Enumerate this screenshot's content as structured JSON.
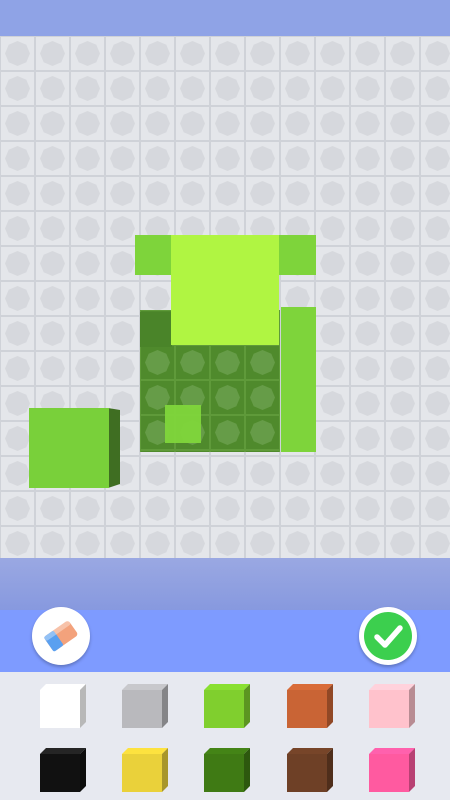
{
  "colors": {
    "top_bar": "#8fa3e6",
    "toolbar": "#7e9bff",
    "palette_bg": "#e7e9f0",
    "board_bg": "#e6e8ec",
    "light_green": "#b0f542",
    "mid_green": "#7ed43b",
    "dark_green": "#4f8a2c",
    "confirm_green": "#3ccf4e"
  },
  "toolbar": {
    "eraser_icon": "eraser-icon",
    "confirm_icon": "checkmark-icon"
  },
  "palette": {
    "swatches": [
      {
        "name": "white",
        "color": "#ffffff"
      },
      {
        "name": "gray",
        "color": "#b9b9bd"
      },
      {
        "name": "lime-green",
        "color": "#80cf2e"
      },
      {
        "name": "orange-brown",
        "color": "#c96435"
      },
      {
        "name": "light-pink",
        "color": "#ffc2cc"
      },
      {
        "name": "black",
        "color": "#111111"
      },
      {
        "name": "yellow",
        "color": "#ead13a"
      },
      {
        "name": "dark-green",
        "color": "#3f7a14"
      },
      {
        "name": "brown",
        "color": "#6e4026"
      },
      {
        "name": "pink",
        "color": "#ff5aa0"
      }
    ]
  }
}
